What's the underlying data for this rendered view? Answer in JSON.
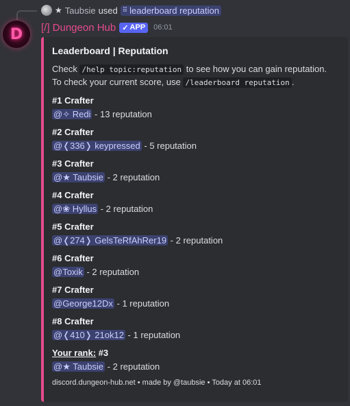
{
  "reply": {
    "username": "Taubsie",
    "star": "★",
    "used_text": "used",
    "command": "leaderboard reputation"
  },
  "message": {
    "avatar_letter": "D",
    "author": "[/] Dungeon Hub",
    "app_badge": "APP",
    "time": "06:01"
  },
  "embed": {
    "accent_color": "#e64b8d",
    "title": "Leaderboard | Reputation",
    "desc": {
      "l1_pre": "Check ",
      "l1_code": "/help topic:reputation",
      "l1_post": " to see how you can gain reputation.",
      "l2_pre": "To check your current score, use ",
      "l2_code": "/leaderboard reputation",
      "l2_post": "."
    },
    "entries": [
      {
        "rank": "#1 Crafter",
        "mention": "@✧ Redi",
        "score": " - 13 reputation"
      },
      {
        "rank": "#2 Crafter",
        "mention": "@❬336❭ keypressed",
        "score": " - 5 reputation"
      },
      {
        "rank": "#3 Crafter",
        "mention": "@★ Taubsie",
        "score": " - 2 reputation"
      },
      {
        "rank": "#4 Crafter",
        "mention": "@❀ Hyllus",
        "score": " - 2 reputation"
      },
      {
        "rank": "#5 Crafter",
        "mention": "@❬274❭ GelsTeRfAhRer19",
        "score": " - 2 reputation"
      },
      {
        "rank": "#6 Crafter",
        "mention": "@Toxik",
        "score": " - 2 reputation"
      },
      {
        "rank": "#7 Crafter",
        "mention": "@George12Dx",
        "score": " - 1 reputation"
      },
      {
        "rank": "#8 Crafter",
        "mention": "@❬410❭ 21ok12",
        "score": " - 1 reputation"
      }
    ],
    "your_rank": {
      "label": "Your rank:",
      "rank": " #3",
      "mention": "@★ Taubsie",
      "score": " - 2 reputation"
    },
    "footer": "discord.dungeon-hub.net • made by @taubsie • Today at 06:01"
  }
}
